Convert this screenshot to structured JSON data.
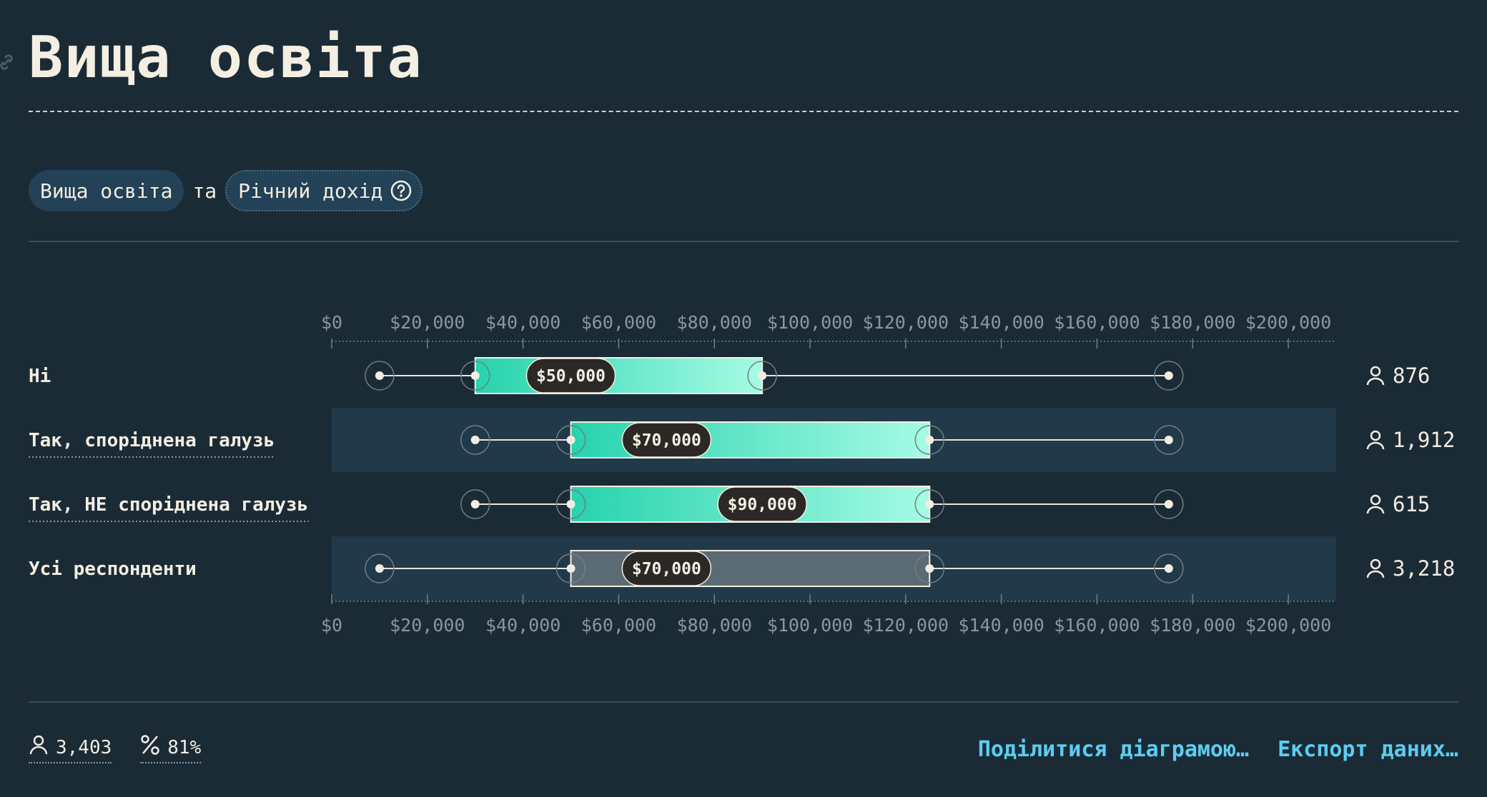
{
  "page": {
    "title": "Вища освіта"
  },
  "filters": {
    "first": "Вища освіта",
    "connector": "та",
    "second": "Річний дохід"
  },
  "chart_data": {
    "type": "boxplot",
    "orientation": "horizontal",
    "xlim": [
      0,
      210000
    ],
    "ticks": [
      0,
      20000,
      40000,
      60000,
      80000,
      100000,
      120000,
      140000,
      160000,
      180000,
      200000
    ],
    "tick_labels": [
      "$0",
      "$20,000",
      "$40,000",
      "$60,000",
      "$80,000",
      "$100,000",
      "$120,000",
      "$140,000",
      "$160,000",
      "$180,000",
      "$200,000"
    ],
    "rows": [
      {
        "label": "Ні",
        "min": 10000,
        "q1": 30000,
        "median": 50000,
        "median_label": "$50,000",
        "q3": 90000,
        "max": 175000,
        "count": "876",
        "shaded": false,
        "highlight": true,
        "underlined": false
      },
      {
        "label": "Так, споріднена галузь",
        "min": 30000,
        "q1": 50000,
        "median": 70000,
        "median_label": "$70,000",
        "q3": 125000,
        "max": 175000,
        "count": "1,912",
        "shaded": true,
        "highlight": true,
        "underlined": true
      },
      {
        "label": "Так, НЕ споріднена галузь",
        "min": 30000,
        "q1": 50000,
        "median": 90000,
        "median_label": "$90,000",
        "q3": 125000,
        "max": 175000,
        "count": "615",
        "shaded": false,
        "highlight": true,
        "underlined": true
      },
      {
        "label": "Усі респонденти",
        "min": 10000,
        "q1": 50000,
        "median": 70000,
        "median_label": "$70,000",
        "q3": 125000,
        "max": 175000,
        "count": "3,218",
        "shaded": true,
        "highlight": false,
        "underlined": false
      }
    ],
    "colors": {
      "box_start": "#26d3ad",
      "box_end": "#a6fbe4",
      "box_neutral": "#5a6b74",
      "row_shade": "#213949",
      "label_pill": "#2c2826"
    }
  },
  "footer": {
    "respondents": "3,403",
    "percent": "81%",
    "share_label": "Поділитися діаграмою…",
    "export_label": "Експорт даних…"
  },
  "colors": {
    "background": "#1b2b36",
    "accent_link": "#5ccdf1",
    "text": "#f2ede0",
    "pill": "#234157"
  },
  "icons": {
    "title_link": "link-icon",
    "help": "help-circle-icon",
    "person": "person-icon",
    "percent": "percent-icon"
  }
}
